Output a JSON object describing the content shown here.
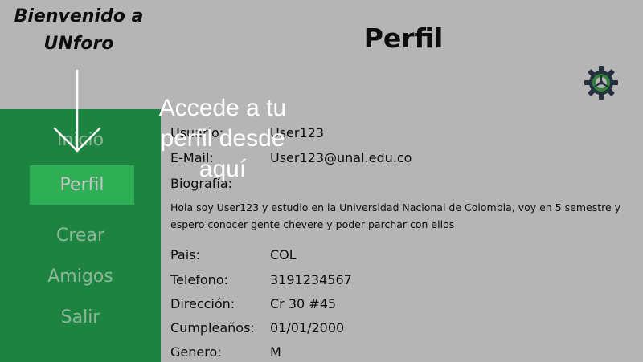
{
  "header": {
    "welcome_line1": "Bienvenido a",
    "welcome_line2": "UNforo",
    "title": "Perfil"
  },
  "sidebar": {
    "items": [
      {
        "label": "Inicio",
        "active": false
      },
      {
        "label": "Perfil",
        "active": true
      },
      {
        "label": "Crear",
        "active": false
      },
      {
        "label": "Amigos",
        "active": false
      },
      {
        "label": "Salir",
        "active": false
      }
    ]
  },
  "profile": {
    "username_label": "Usuario:",
    "username": "User123",
    "email_label": "E-Mail:",
    "email": "User123@unal.edu.co",
    "bio_label": "Biografía:",
    "bio": "Hola soy User123 y estudio en la Universidad Nacional de Colombia, voy en 5 semestre y espero conocer gente chevere y poder parchar con ellos",
    "country_label": "Pais:",
    "country": "COL",
    "phone_label": "Telefono:",
    "phone": "3191234567",
    "address_label": "Dirección:",
    "address": "Cr 30 #45",
    "birthday_label": "Cumpleaños:",
    "birthday": "01/01/2000",
    "gender_label": "Genero:",
    "gender": "M"
  },
  "tutorial": {
    "line1": "Accede a tu",
    "line2": "perfil desde",
    "line3": "aquí"
  },
  "icons": {
    "settings": "gear-icon"
  },
  "colors": {
    "sidebar": "#24a952",
    "active_item": "#3be16f",
    "gear": "#2f3e50"
  }
}
